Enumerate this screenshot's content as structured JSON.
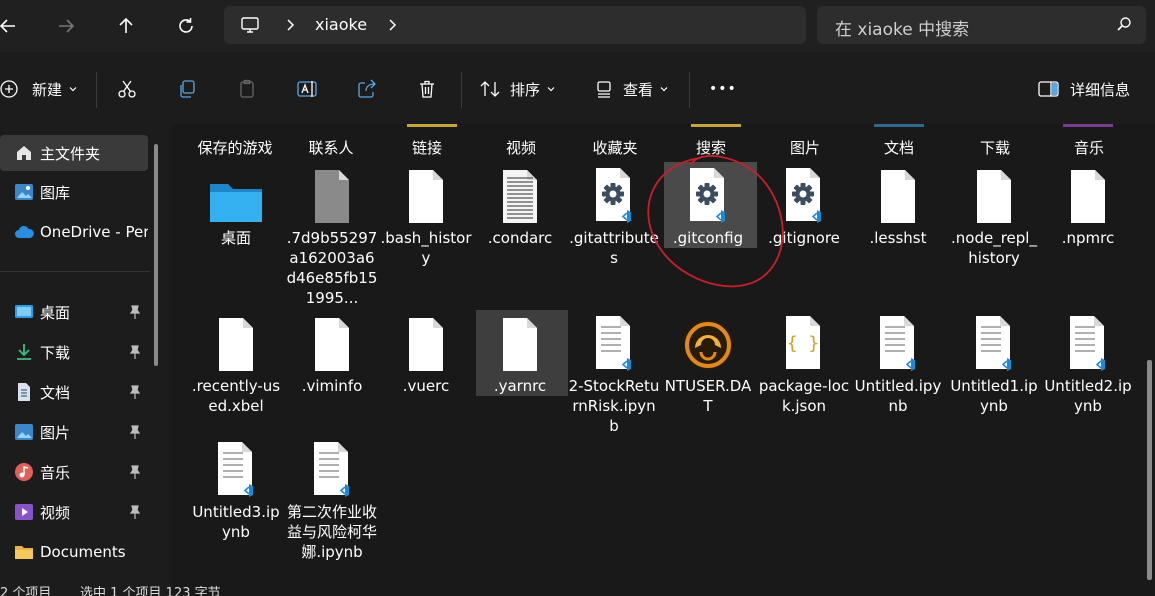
{
  "address_bar": {
    "crumb": "xiaoke",
    "search_placeholder": "在 xiaoke 中搜索"
  },
  "toolbar": {
    "new_label": "新建",
    "sort_label": "排序",
    "view_label": "查看",
    "more_label": "•••",
    "details_label": "详细信息"
  },
  "sidebar": {
    "items": [
      {
        "label": "主文件夹",
        "icon": "home-icon"
      },
      {
        "label": "图库",
        "icon": "gallery-icon"
      },
      {
        "label": "OneDrive - Per",
        "icon": "cloud-icon"
      },
      {
        "label": "桌面",
        "icon": "desktop-icon"
      },
      {
        "label": "下载",
        "icon": "download-icon"
      },
      {
        "label": "文档",
        "icon": "document-icon"
      },
      {
        "label": "图片",
        "icon": "pictures-icon"
      },
      {
        "label": "音乐",
        "icon": "music-icon"
      },
      {
        "label": "视频",
        "icon": "video-icon"
      },
      {
        "label": "Documents",
        "icon": "folder-icon"
      }
    ]
  },
  "top_row": [
    "保存的游戏",
    "联系人",
    "链接",
    "视频",
    "收藏夹",
    "搜索",
    "图片",
    "文档",
    "下载",
    "音乐"
  ],
  "files": [
    {
      "label": "桌面",
      "type": "folder"
    },
    {
      "label": ".7d9b55297a162003a6d46e85fb151995...",
      "type": "gray"
    },
    {
      "label": ".bash_history",
      "type": "blank"
    },
    {
      "label": ".condarc",
      "type": "text"
    },
    {
      "label": ".gitattributes",
      "type": "config"
    },
    {
      "label": ".gitconfig",
      "type": "config"
    },
    {
      "label": ".gitignore",
      "type": "config"
    },
    {
      "label": ".lesshst",
      "type": "blank"
    },
    {
      "label": ".node_repl_history",
      "type": "blank"
    },
    {
      "label": ".npmrc",
      "type": "blank"
    },
    {
      "label": ".recently-used.xbel",
      "type": "blank"
    },
    {
      "label": ".viminfo",
      "type": "blank"
    },
    {
      "label": ".vuerc",
      "type": "blank"
    },
    {
      "label": ".yarnrc",
      "type": "blank"
    },
    {
      "label": "2-StockReturnRisk.ipynb",
      "type": "notebook"
    },
    {
      "label": "NTUSER.DAT",
      "type": "ntuser"
    },
    {
      "label": "package-lock.json",
      "type": "json"
    },
    {
      "label": "Untitled.ipynb",
      "type": "notebook"
    },
    {
      "label": "Untitled1.ipynb",
      "type": "notebook"
    },
    {
      "label": "Untitled2.ipynb",
      "type": "notebook"
    },
    {
      "label": "Untitled3.ipynb",
      "type": "notebook"
    },
    {
      "label": "第二次作业收益与风险柯华娜.ipynb",
      "type": "notebook"
    }
  ],
  "status": {
    "count": "2 个项目",
    "selected": "选中 1 个项目  123 字节"
  },
  "colors": {
    "background": "#191919",
    "selection": "#4a4a4a",
    "annotation": "#c8202a",
    "folder": "#2d9fe0",
    "vscode_blue": "#1f8ad2"
  }
}
